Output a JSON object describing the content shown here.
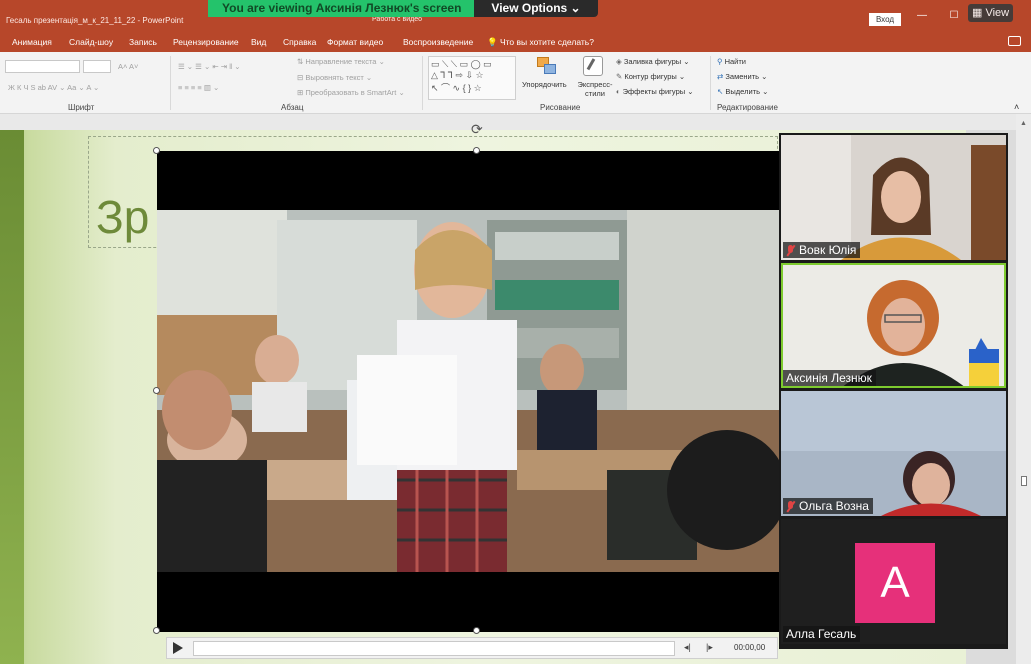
{
  "window": {
    "doc_title": "Гесаль презентація_м_к_21_11_22 - PowerPoint",
    "context_tab": "Работа с видео",
    "signin": "Вход",
    "min": "—",
    "restore": "☐",
    "close": "✕"
  },
  "zoom": {
    "banner": "You are viewing Аксинія Лезнюк's screen",
    "view_options": "View Options ⌄",
    "view_button": "View"
  },
  "tabs": [
    {
      "label": "Анимация"
    },
    {
      "label": "Слайд-шоу"
    },
    {
      "label": "Запись"
    },
    {
      "label": "Рецензирование"
    },
    {
      "label": "Вид"
    },
    {
      "label": "Справка"
    },
    {
      "label": "Формат видео"
    },
    {
      "label": "Воспроизведение"
    },
    {
      "label": "Что вы хотите сделать?"
    }
  ],
  "ribbon": {
    "font_group": "Шрифт",
    "paragraph_group": "Абзац",
    "drawing_group": "Рисование",
    "editing_group": "Редактирование",
    "text_direction": "Направление текста",
    "align_text": "Выровнять текст",
    "convert_smartart": "Преобразовать в SmartArt",
    "arrange": "Упорядочить",
    "quick_styles": "Экспресс-стили",
    "shape_fill": "Заливка фигуры",
    "shape_outline": "Контур фигуры",
    "shape_effects": "Эффекты фигуры",
    "find": "Найти",
    "replace": "Заменить",
    "select": "Выделить"
  },
  "slide": {
    "title_fragment": "Зр"
  },
  "video": {
    "time": "00:00,00"
  },
  "participants": [
    {
      "name": "Вовк Юлія",
      "muted": true
    },
    {
      "name": "Аксинія Лезнюк",
      "muted": false
    },
    {
      "name": "Ольга Вознa",
      "muted": true
    },
    {
      "name": "Алла Гесаль",
      "muted": false,
      "initial": "A"
    }
  ],
  "colors": {
    "ppt_red": "#b7472a",
    "zoom_green": "#24c36b",
    "avatar_pink": "#e6307a",
    "speaking_outline": "#7ecb2f"
  }
}
